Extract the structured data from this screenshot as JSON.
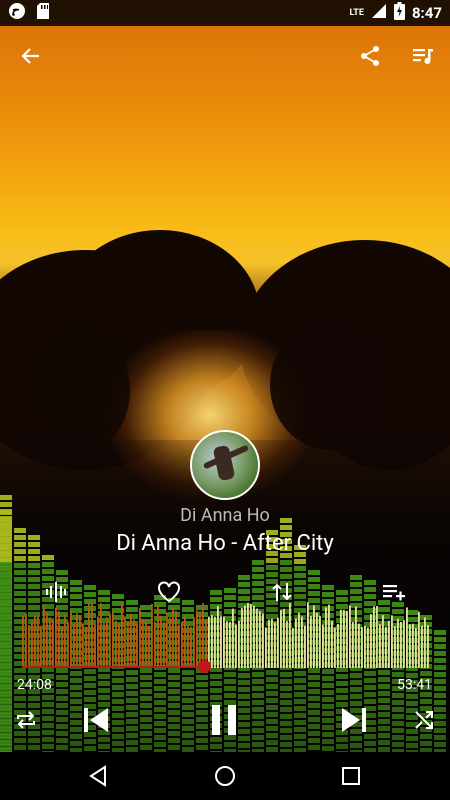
{
  "status_bar": {
    "time": "8:47",
    "network": "LTE",
    "icons": [
      "app-notification-icon",
      "sd-card-icon",
      "signal-icon",
      "battery-charging-icon"
    ]
  },
  "app_bar": {
    "icons": [
      "back-arrow-icon",
      "share-icon",
      "queue-music-icon"
    ]
  },
  "now_playing": {
    "artist": "Di Anna Ho",
    "title": "Di Anna Ho - After City"
  },
  "actions": {
    "icons": [
      "equalizer-icon",
      "favorite-heart-icon",
      "swap-vertical-icon",
      "add-to-playlist-icon"
    ]
  },
  "progress": {
    "elapsed": "24:08",
    "duration": "53:41",
    "fraction": 0.45
  },
  "transport": {
    "icons": [
      "repeat-icon",
      "previous-track-icon",
      "pause-icon",
      "next-track-icon",
      "shuffle-icon"
    ]
  },
  "nav_bar": {
    "icons": [
      "nav-back-icon",
      "nav-home-icon",
      "nav-recents-icon"
    ]
  },
  "colors": {
    "accent": "#c1171a",
    "wave_played": "#b55a12",
    "wave_remaining": "#e2e29a",
    "eq_green": "#3f8f16",
    "eq_yellow": "#a8b81c"
  }
}
